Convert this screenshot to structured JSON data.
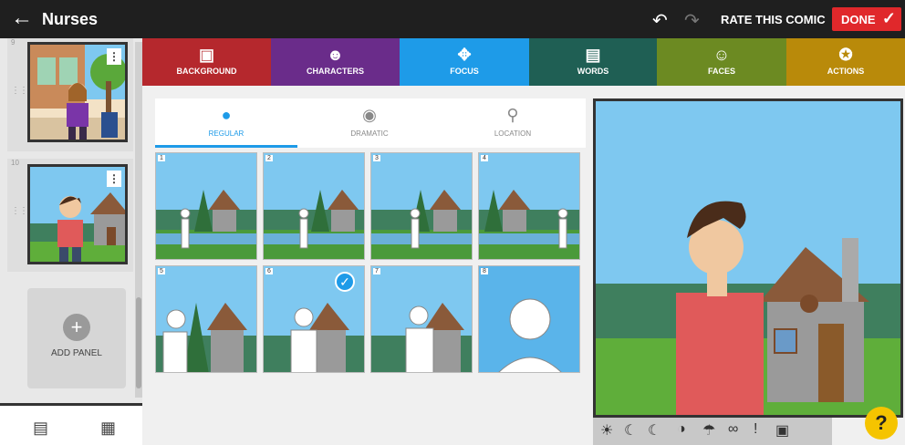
{
  "header": {
    "title": "Nurses",
    "rate_label": "RATE THIS COMIC",
    "done_label": "DONE"
  },
  "sidebar": {
    "panels": [
      {
        "number": "9"
      },
      {
        "number": "10"
      }
    ],
    "add_panel_label": "ADD PANEL"
  },
  "tabs": [
    {
      "label": "BACKGROUND",
      "color": "#b5282d"
    },
    {
      "label": "CHARACTERS",
      "color": "#6a2c8a"
    },
    {
      "label": "FOCUS",
      "color": "#1e9be8"
    },
    {
      "label": "WORDS",
      "color": "#1f5f54"
    },
    {
      "label": "FACES",
      "color": "#6c8a22"
    },
    {
      "label": "ACTIONS",
      "color": "#b98a0a"
    }
  ],
  "subtabs": [
    {
      "label": "REGULAR",
      "active": true
    },
    {
      "label": "DRAMATIC",
      "active": false
    },
    {
      "label": "LOCATION",
      "active": false
    }
  ],
  "tiles": [
    "1",
    "2",
    "3",
    "4",
    "5",
    "6",
    "7",
    "8"
  ],
  "selected_tile": "6",
  "colors": {
    "accent": "#1e9be8",
    "done": "#e0282b",
    "help": "#f5c400"
  }
}
